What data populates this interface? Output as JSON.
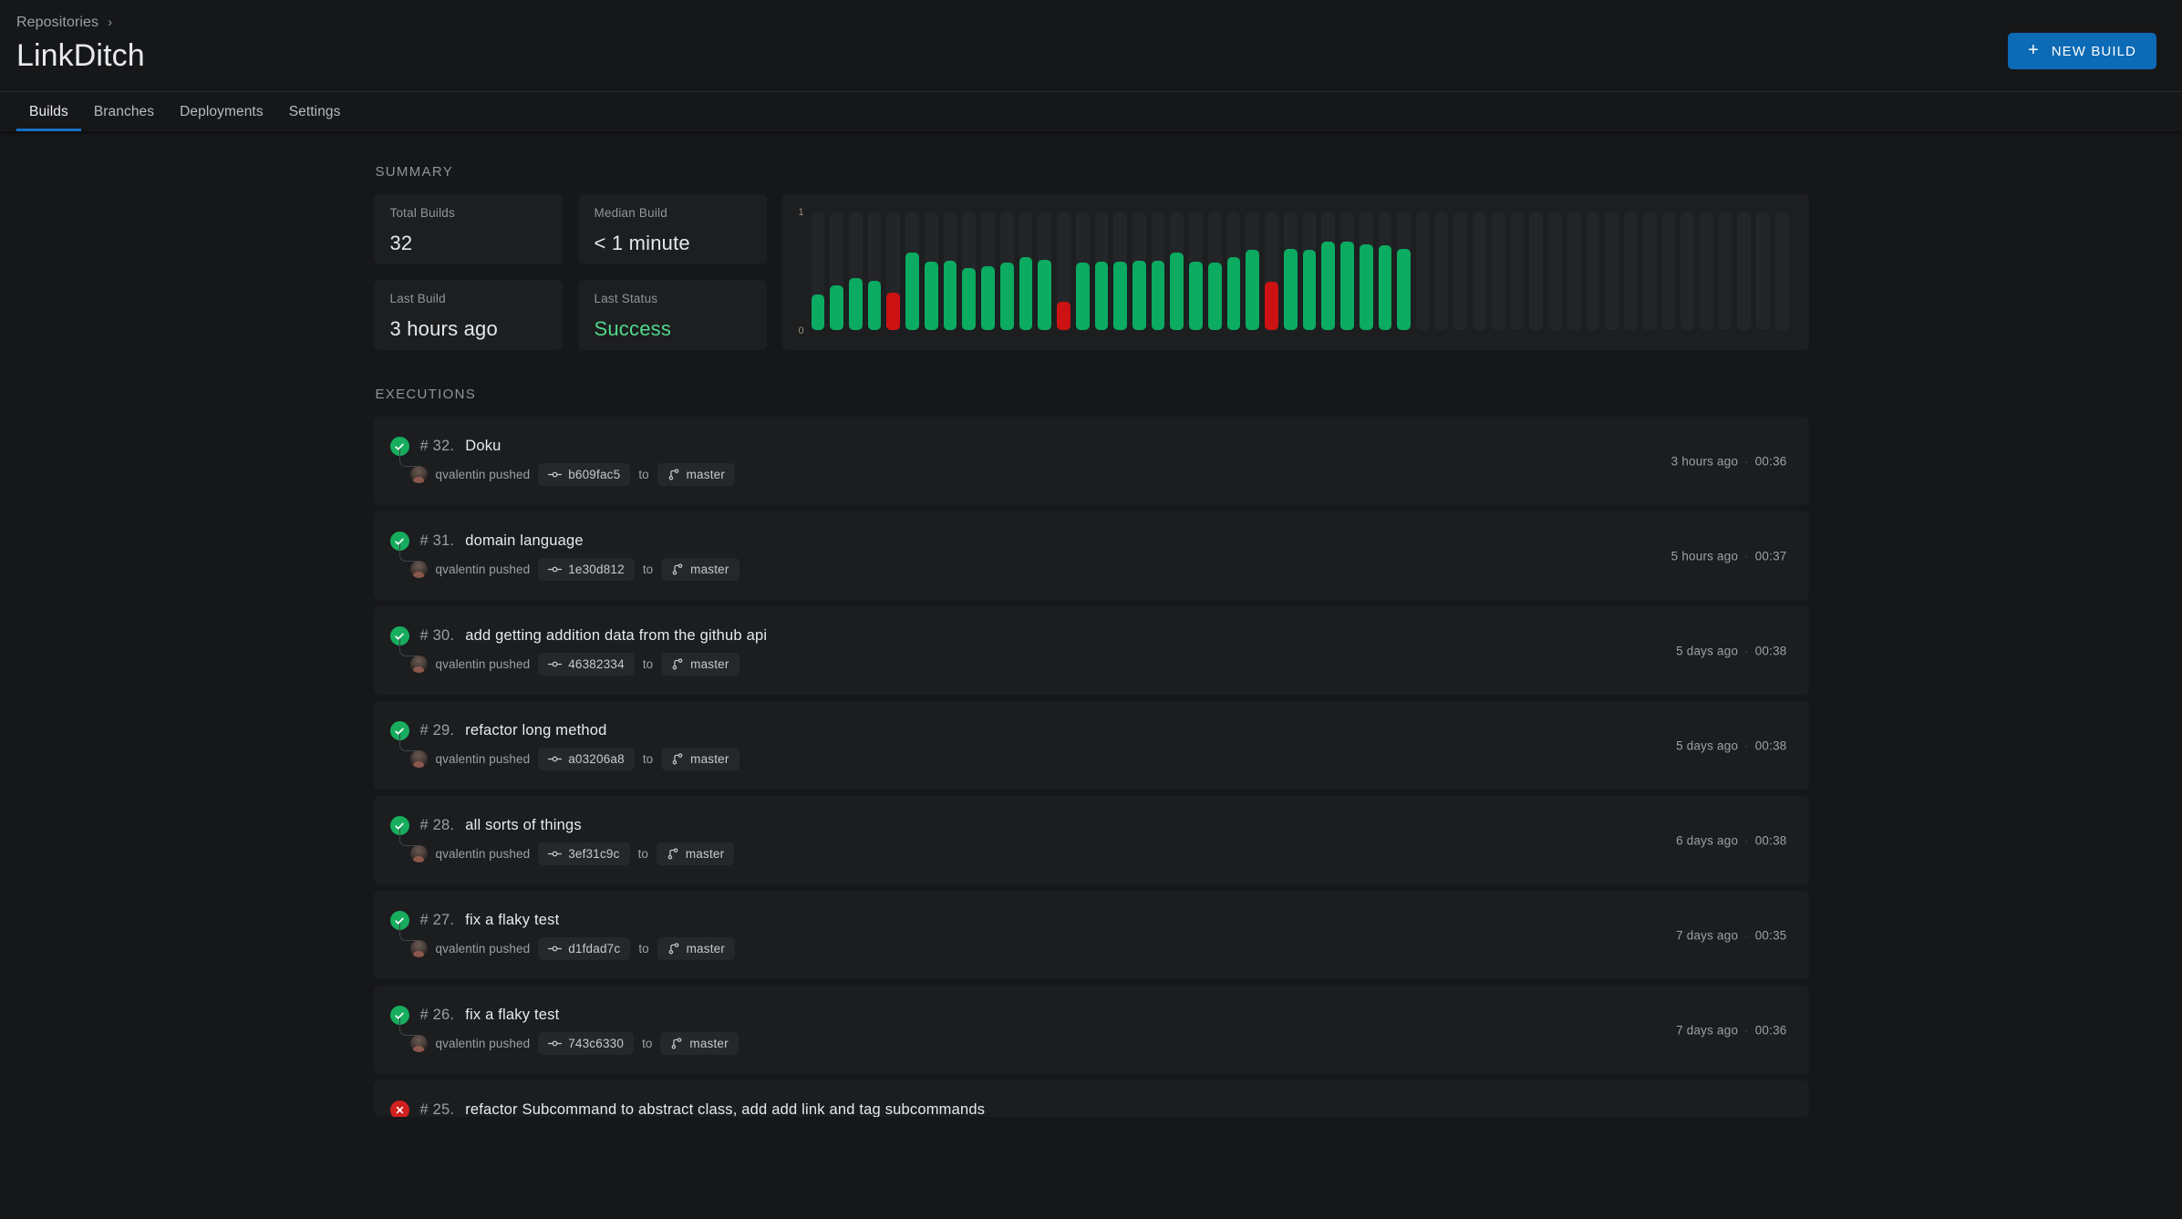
{
  "header": {
    "breadcrumb": "Repositories",
    "breadcrumb_separator": "›",
    "title": "LinkDitch",
    "new_build_label": "NEW BUILD",
    "new_build_icon": "plus-icon",
    "accent_color": "#0d6ab5"
  },
  "tabs": [
    {
      "label": "Builds",
      "active": true
    },
    {
      "label": "Branches",
      "active": false
    },
    {
      "label": "Deployments",
      "active": false
    },
    {
      "label": "Settings",
      "active": false
    }
  ],
  "summary": {
    "section_label": "SUMMARY",
    "cards": [
      {
        "label": "Total Builds",
        "value": "32",
        "state": "normal"
      },
      {
        "label": "Median Build",
        "value": "< 1 minute",
        "state": "normal"
      },
      {
        "label": "Last Build",
        "value": "3 hours ago",
        "state": "normal"
      },
      {
        "label": "Last Status",
        "value": "Success",
        "state": "success"
      }
    ]
  },
  "chart_data": {
    "type": "bar",
    "title": "",
    "xlabel": "",
    "ylabel": "",
    "ylim": [
      0,
      1
    ],
    "ytick_labels": [
      "1",
      "0"
    ],
    "grid": false,
    "legend": "none",
    "total_slots": 52,
    "success_color": "#0bab61",
    "failure_color": "#cc1212",
    "track_color": "#232528",
    "categories": [
      "1",
      "2",
      "3",
      "4",
      "5",
      "6",
      "7",
      "8",
      "9",
      "10",
      "11",
      "12",
      "13",
      "14",
      "15",
      "16",
      "17",
      "18",
      "19",
      "20",
      "21",
      "22",
      "23",
      "24",
      "25",
      "26",
      "27",
      "28",
      "29",
      "30",
      "31",
      "32"
    ],
    "values": [
      0.3,
      0.38,
      0.44,
      0.42,
      0.32,
      0.66,
      0.58,
      0.59,
      0.53,
      0.54,
      0.57,
      0.62,
      0.6,
      0.24,
      0.57,
      0.58,
      0.58,
      0.59,
      0.59,
      0.66,
      0.58,
      0.57,
      0.62,
      0.68,
      0.41,
      0.69,
      0.68,
      0.75,
      0.75,
      0.73,
      0.72,
      0.69
    ],
    "statuses": [
      "success",
      "success",
      "success",
      "success",
      "failure",
      "success",
      "success",
      "success",
      "success",
      "success",
      "success",
      "success",
      "success",
      "failure",
      "success",
      "success",
      "success",
      "success",
      "success",
      "success",
      "success",
      "success",
      "success",
      "success",
      "failure",
      "success",
      "success",
      "success",
      "success",
      "success",
      "success",
      "success"
    ],
    "empty_slots": 20
  },
  "executions": {
    "section_label": "EXECUTIONS",
    "to_word": "to",
    "meta_separator": "·",
    "commit_icon": "commit-icon",
    "branch_icon": "branch-icon",
    "rows": [
      {
        "status": "success",
        "number": "# 32.",
        "title": "Doku",
        "pusher": "qvalentin pushed",
        "commit": "b609fac5",
        "branch": "master",
        "age": "3 hours ago",
        "duration": "00:36"
      },
      {
        "status": "success",
        "number": "# 31.",
        "title": "domain language",
        "pusher": "qvalentin pushed",
        "commit": "1e30d812",
        "branch": "master",
        "age": "5 hours ago",
        "duration": "00:37"
      },
      {
        "status": "success",
        "number": "# 30.",
        "title": "add getting addition data from the github api",
        "pusher": "qvalentin pushed",
        "commit": "46382334",
        "branch": "master",
        "age": "5 days ago",
        "duration": "00:38"
      },
      {
        "status": "success",
        "number": "# 29.",
        "title": "refactor long method",
        "pusher": "qvalentin pushed",
        "commit": "a03206a8",
        "branch": "master",
        "age": "5 days ago",
        "duration": "00:38"
      },
      {
        "status": "success",
        "number": "# 28.",
        "title": "all sorts of things",
        "pusher": "qvalentin pushed",
        "commit": "3ef31c9c",
        "branch": "master",
        "age": "6 days ago",
        "duration": "00:38"
      },
      {
        "status": "success",
        "number": "# 27.",
        "title": "fix a flaky test",
        "pusher": "qvalentin pushed",
        "commit": "d1fdad7c",
        "branch": "master",
        "age": "7 days ago",
        "duration": "00:35"
      },
      {
        "status": "success",
        "number": "# 26.",
        "title": "fix a flaky test",
        "pusher": "qvalentin pushed",
        "commit": "743c6330",
        "branch": "master",
        "age": "7 days ago",
        "duration": "00:36"
      },
      {
        "status": "failure",
        "number": "# 25.",
        "title": "refactor Subcommand to abstract class, add add link and tag subcommands",
        "pusher": "",
        "commit": "",
        "branch": "",
        "age": "",
        "duration": ""
      }
    ]
  }
}
